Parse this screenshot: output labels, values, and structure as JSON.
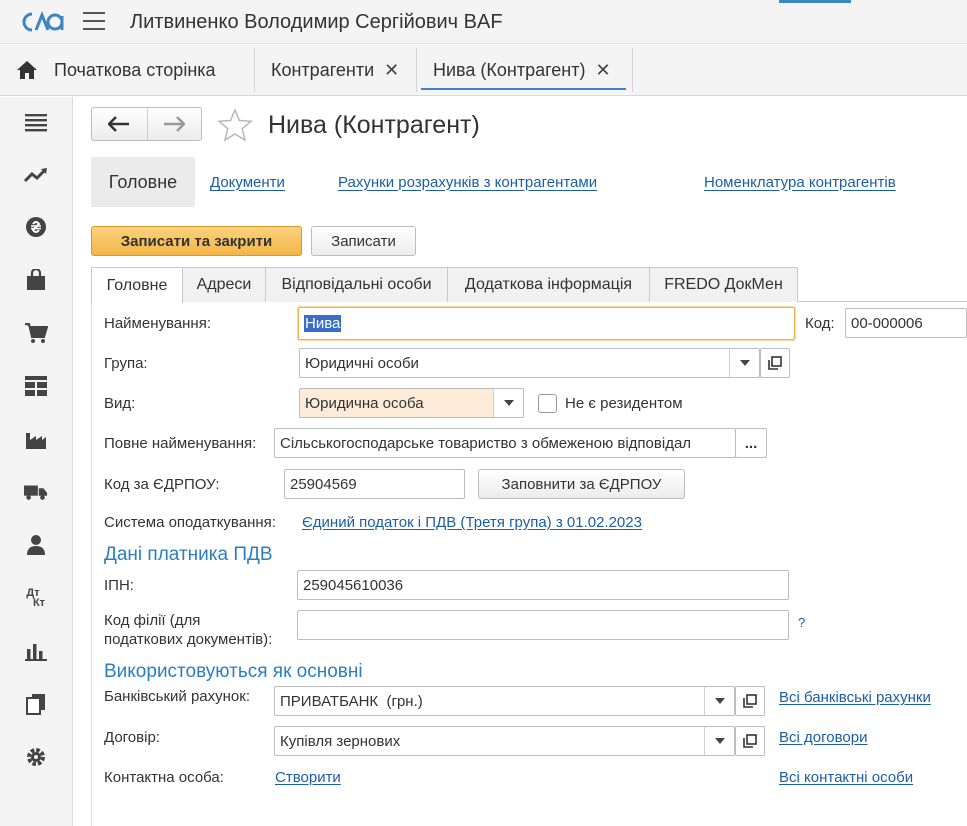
{
  "app": {
    "title": "Литвиненко Володимир Сергійович BAF"
  },
  "open_tabs": [
    {
      "label": "Початкова сторінка"
    },
    {
      "label": "Контрагенти",
      "close": "✕"
    },
    {
      "label": "Нива (Контрагент)",
      "close": "✕"
    }
  ],
  "sidebar": {
    "icons": [
      "menu-icon",
      "chart-trend-icon",
      "currency-icon",
      "bag-icon",
      "cart-icon",
      "grid-icon",
      "factory-icon",
      "truck-icon",
      "person-icon",
      "debit-credit-icon",
      "bar-chart-icon",
      "documents-icon",
      "gear-icon"
    ],
    "dt_kt": {
      "top": "Дт",
      "bottom": "Кт"
    }
  },
  "form": {
    "title": "Нива (Контрагент)",
    "sections": {
      "active": "Головне",
      "links": [
        "Документи",
        "Рахунки розрахунків з контрагентами",
        "Номенклатура контрагентів"
      ]
    },
    "buttons": {
      "save_close": "Записати та закрити",
      "save": "Записати",
      "fill_edrpou": "Заповнити за ЄДРПОУ",
      "more": "..."
    },
    "tabs": [
      "Головне",
      "Адреси",
      "Відповідальні особи",
      "Додаткова інформація",
      "FREDO ДокМен"
    ],
    "fields": {
      "name": {
        "label": "Найменування:",
        "value": "Нива"
      },
      "code": {
        "label": "Код:",
        "value": "00-000006"
      },
      "group": {
        "label": "Група:",
        "value": "Юридичні особи"
      },
      "kind": {
        "label": "Вид:",
        "value": "Юридична особа"
      },
      "non_resident": {
        "label": "Не є резидентом",
        "checked": false
      },
      "full_name": {
        "label": "Повне найменування:",
        "value": "Сільськогосподарське товариство з обмеженою відповідал"
      },
      "edrpou": {
        "label": "Код за ЄДРПОУ:",
        "value": "25904569"
      },
      "tax_system": {
        "label": "Система оподаткування:",
        "value": "Єдиний податок і ПДВ (Третя група) з 01.02.2023"
      }
    },
    "vat": {
      "heading": "Дані платника ПДВ",
      "ipn": {
        "label": "ІПН:",
        "value": "259045610036"
      },
      "branch_code": {
        "label_line1": "Код філії (для",
        "label_line2": "податкових документів):",
        "value": "",
        "help": "?"
      }
    },
    "defaults": {
      "heading": "Використовуються як основні",
      "bank_account": {
        "label": "Банківський рахунок:",
        "value": "ПРИВАТБАНК  (грн.)",
        "link": "Всі банківські рахунки"
      },
      "contract": {
        "label": "Договір:",
        "value": "Купівля зернових",
        "link": "Всі договори"
      },
      "contact": {
        "label": "Контактна особа:",
        "create": "Створити",
        "link": "Всі контактні особи"
      }
    }
  },
  "colors": {
    "accent": "#3d86c6",
    "link": "#1b5fa6",
    "heading": "#2b7fc1",
    "primary_button": "#f4b548",
    "selection": "#3a6ec8"
  }
}
